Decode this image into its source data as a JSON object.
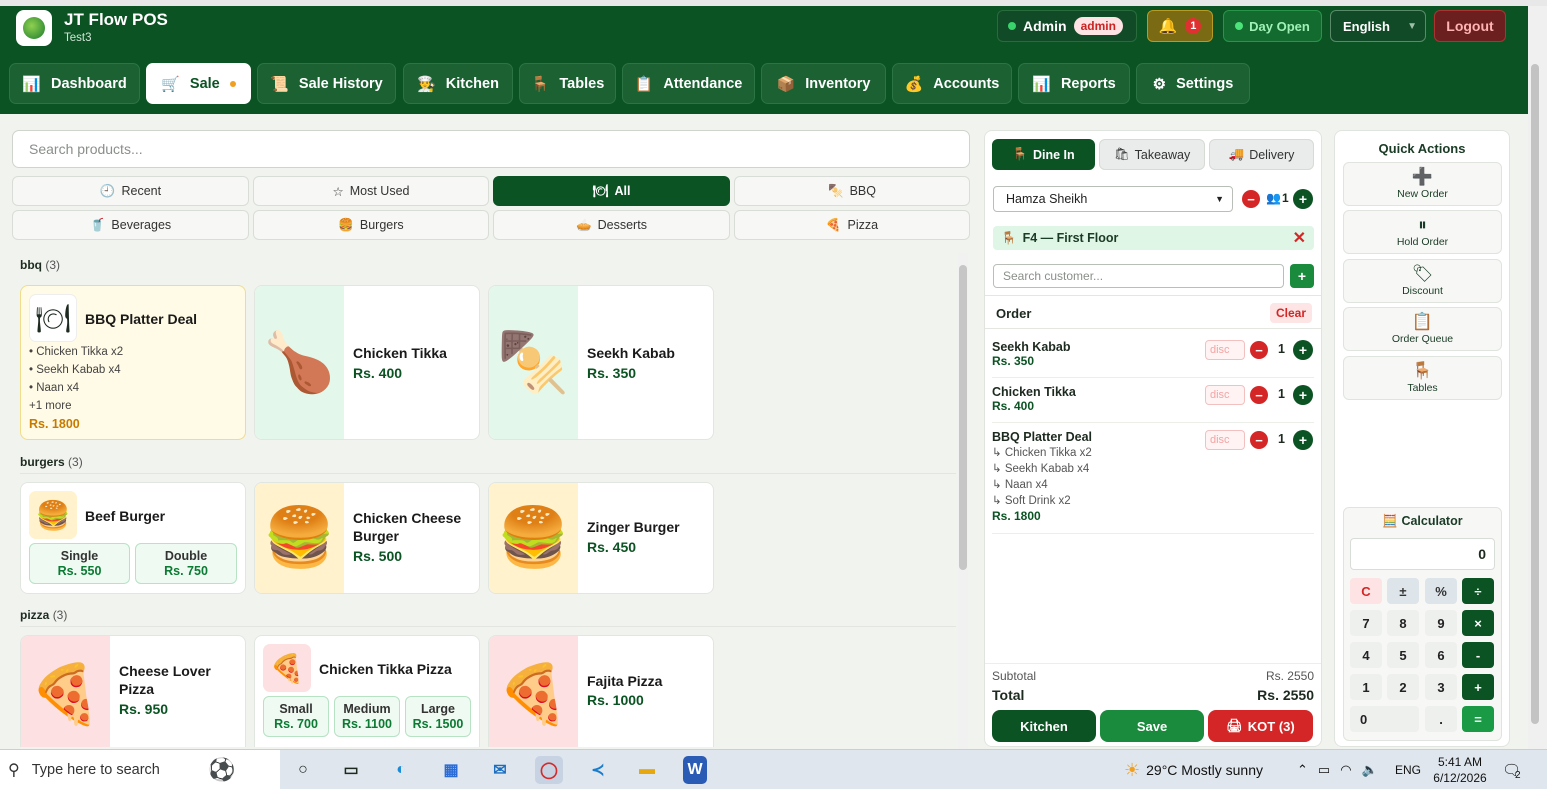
{
  "header": {
    "app_title": "JT Flow POS",
    "app_subtitle": "Test3",
    "user": "Admin",
    "role": "admin",
    "notif_count": "1",
    "day_status": "Day Open",
    "language": "English",
    "logout": "Logout"
  },
  "nav": {
    "tabs": [
      {
        "label": "Dashboard",
        "icon": "📊"
      },
      {
        "label": "Sale",
        "icon": "🛒"
      },
      {
        "label": "Sale History",
        "icon": "📜"
      },
      {
        "label": "Kitchen",
        "icon": "👨‍🍳"
      },
      {
        "label": "Tables",
        "icon": "🪑"
      },
      {
        "label": "Attendance",
        "icon": "📋"
      },
      {
        "label": "Inventory",
        "icon": "📦"
      },
      {
        "label": "Accounts",
        "icon": "💰"
      },
      {
        "label": "Reports",
        "icon": "📊"
      },
      {
        "label": "Settings",
        "icon": "⚙"
      }
    ],
    "active": "Sale"
  },
  "search": {
    "placeholder": "Search products..."
  },
  "categories": [
    {
      "label": "Recent",
      "icon": "🕘"
    },
    {
      "label": "Most Used",
      "icon": "☆"
    },
    {
      "label": "All",
      "icon": "🍽"
    },
    {
      "label": "BBQ",
      "icon": "🍢"
    },
    {
      "label": "Beverages",
      "icon": "🥤"
    },
    {
      "label": "Burgers",
      "icon": "🍔"
    },
    {
      "label": "Desserts",
      "icon": "🥧"
    },
    {
      "label": "Pizza",
      "icon": "🍕"
    }
  ],
  "sections": {
    "bbq": {
      "name": "bbq",
      "count": "(3)"
    },
    "burgers": {
      "name": "burgers",
      "count": "(3)"
    },
    "pizza": {
      "name": "pizza",
      "count": "(3)"
    }
  },
  "products": {
    "bbq_deal": {
      "name": "BBQ Platter Deal",
      "items": [
        "• Chicken Tikka x2",
        "• Seekh Kabab x4",
        "• Naan x4",
        "+1 more"
      ],
      "price": "Rs. 1800",
      "icon": "🍽"
    },
    "chicken_tikka": {
      "name": "Chicken Tikka",
      "price": "Rs. 400",
      "icon": "🍗"
    },
    "seekh_kabab": {
      "name": "Seekh Kabab",
      "price": "Rs. 350",
      "icon": "🍢"
    },
    "beef_burger": {
      "name": "Beef Burger",
      "icon": "🍔",
      "variants": [
        {
          "label": "Single",
          "price": "Rs. 550"
        },
        {
          "label": "Double",
          "price": "Rs. 750"
        }
      ]
    },
    "chicken_cheese_burger": {
      "name": "Chicken Cheese Burger",
      "price": "Rs. 500",
      "icon": "🍔"
    },
    "zinger_burger": {
      "name": "Zinger Burger",
      "price": "Rs. 450",
      "icon": "🍔"
    },
    "cheese_lover_pizza": {
      "name": "Cheese Lover Pizza",
      "price": "Rs. 950",
      "icon": "🍕"
    },
    "chicken_tikka_pizza": {
      "name": "Chicken Tikka Pizza",
      "icon": "🍕",
      "variants": [
        {
          "label": "Small",
          "price": "Rs. 700"
        },
        {
          "label": "Medium",
          "price": "Rs. 1100"
        },
        {
          "label": "Large",
          "price": "Rs. 1500"
        }
      ]
    },
    "fajita_pizza": {
      "name": "Fajita Pizza",
      "price": "Rs. 1000",
      "icon": "🍕"
    }
  },
  "order": {
    "types": [
      {
        "label": "Dine In",
        "icon": "🪑"
      },
      {
        "label": "Takeaway",
        "icon": "🛍"
      },
      {
        "label": "Delivery",
        "icon": "🚚"
      }
    ],
    "active_type": "Dine In",
    "waiter": "Hamza Sheikh",
    "guests": "1",
    "table": "F4 — First Floor",
    "customer_placeholder": "Search customer...",
    "title": "Order",
    "clear": "Clear",
    "disc_placeholder": "disc",
    "items": [
      {
        "name": "Seekh Kabab",
        "price": "Rs. 350",
        "qty": "1",
        "sub": []
      },
      {
        "name": "Chicken Tikka",
        "price": "Rs. 400",
        "qty": "1",
        "sub": []
      },
      {
        "name": "BBQ Platter Deal",
        "price": "Rs. 1800",
        "qty": "1",
        "sub": [
          "↳ Chicken Tikka x2",
          "↳ Seekh Kabab x4",
          "↳ Naan x4",
          "↳ Soft Drink x2"
        ]
      }
    ],
    "subtotal_label": "Subtotal",
    "subtotal": "Rs. 2550",
    "total_label": "Total",
    "total": "Rs. 2550",
    "kitchen": "Kitchen",
    "save": "Save",
    "kot": "KOT (3)"
  },
  "quick_actions": {
    "title": "Quick Actions",
    "items": [
      {
        "label": "New Order",
        "icon": "➕"
      },
      {
        "label": "Hold Order",
        "icon": "⏸"
      },
      {
        "label": "Discount",
        "icon": "🏷"
      },
      {
        "label": "Order Queue",
        "icon": "📋"
      },
      {
        "label": "Tables",
        "icon": "🪑"
      }
    ]
  },
  "calculator": {
    "title": "Calculator",
    "display": "0",
    "keys": [
      "C",
      "±",
      "%",
      "÷",
      "7",
      "8",
      "9",
      "×",
      "4",
      "5",
      "6",
      "-",
      "1",
      "2",
      "3",
      "+",
      "0",
      ".",
      "="
    ]
  },
  "taskbar": {
    "search": "Type here to search",
    "weather": "29°C  Mostly sunny",
    "lang": "ENG",
    "time": "5:41 AM",
    "date": "6/12/2026",
    "notif": "2"
  },
  "colors": {
    "primary": "#0b5323",
    "accent": "#1a9a44",
    "danger": "#d42626"
  }
}
